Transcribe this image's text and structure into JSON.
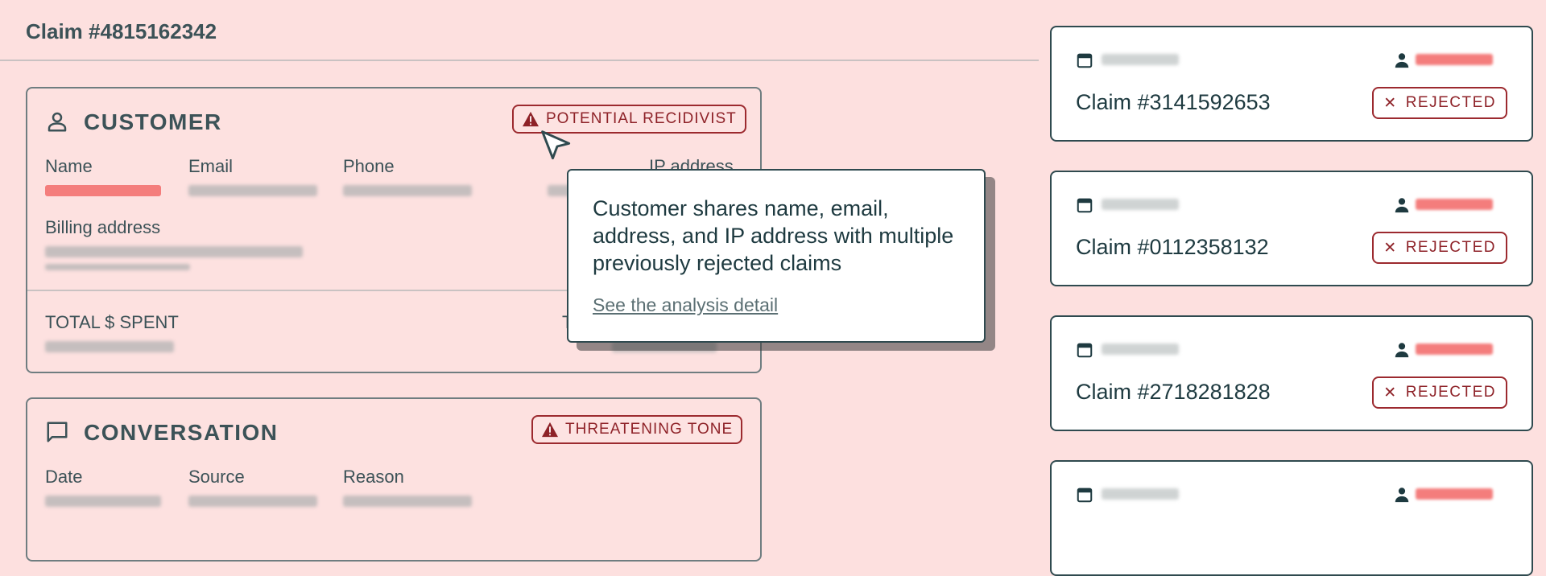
{
  "page": {
    "title": "Claim #4815162342"
  },
  "customer": {
    "section_title": "CUSTOMER",
    "badge_label": "POTENTIAL RECIDIVIST",
    "fields": {
      "name": "Name",
      "email": "Email",
      "phone": "Phone",
      "ip": "IP address"
    },
    "billing_label": "Billing address",
    "total_spent_label": "TOTAL $ SPENT",
    "second_total_label": "T"
  },
  "tooltip": {
    "text": "Customer shares name, email, address, and IP address with multiple previously rejected claims",
    "link": "See the analysis detail"
  },
  "conversation": {
    "section_title": "CONVERSATION",
    "badge_label": "THREATENING TONE",
    "fields": {
      "date": "Date",
      "source": "Source",
      "reason": "Reason"
    }
  },
  "claims": [
    {
      "title": "Claim #3141592653",
      "status": "REJECTED"
    },
    {
      "title": "Claim #0112358132",
      "status": "REJECTED"
    },
    {
      "title": "Claim #2718281828",
      "status": "REJECTED"
    },
    {
      "title": "",
      "status": ""
    }
  ],
  "colors": {
    "background": "#fde0df",
    "danger": "#9c2a2f",
    "text": "#2f4a4f",
    "redacted_red": "#f47d7c"
  }
}
